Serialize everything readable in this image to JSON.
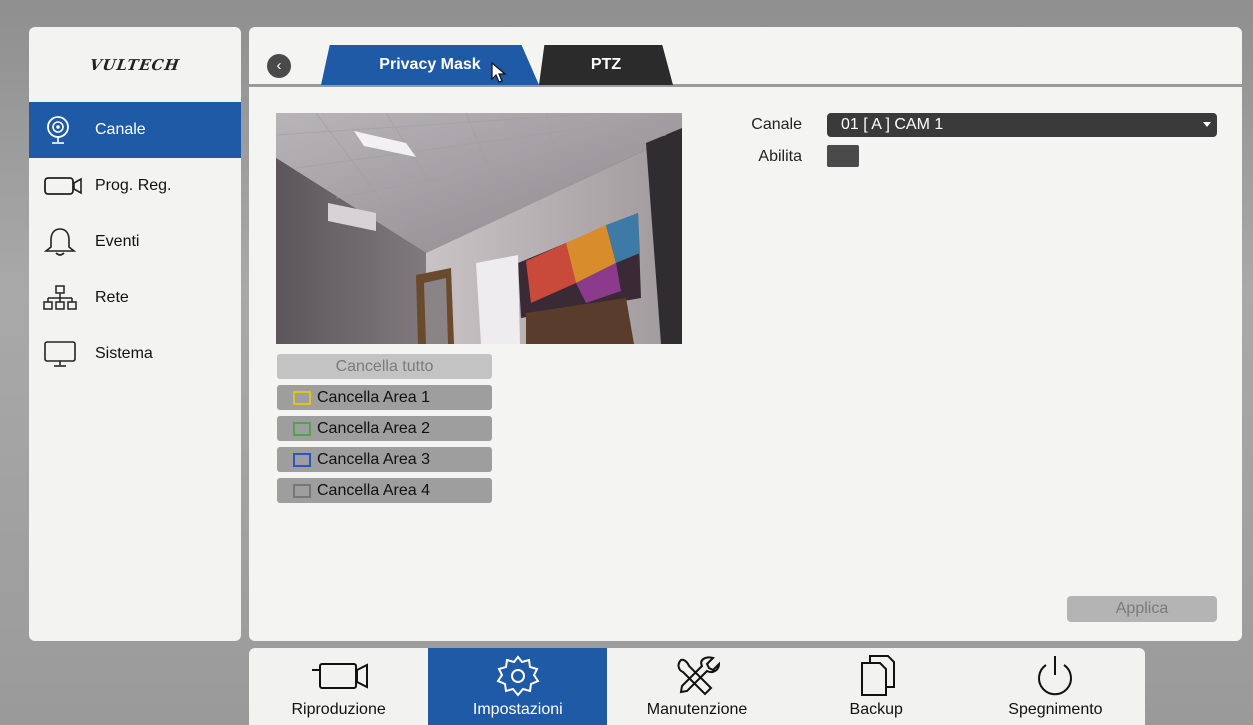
{
  "brand": {
    "logo": "VULTECH"
  },
  "sidebar": {
    "items": [
      {
        "label": "Canale",
        "icon": "camera-icon",
        "active": true
      },
      {
        "label": "Prog. Reg.",
        "icon": "recording-icon",
        "active": false
      },
      {
        "label": "Eventi",
        "icon": "bell-icon",
        "active": false
      },
      {
        "label": "Rete",
        "icon": "network-icon",
        "active": false
      },
      {
        "label": "Sistema",
        "icon": "monitor-icon",
        "active": false
      }
    ]
  },
  "tabs": {
    "back_icon": "chevron-left-icon",
    "items": [
      {
        "label": "Privacy Mask",
        "active": true
      },
      {
        "label": "PTZ",
        "active": false
      }
    ]
  },
  "mask": {
    "clear_all": "Cancella tutto",
    "areas": [
      {
        "label": "Cancella Area 1",
        "color": "#e3c21a"
      },
      {
        "label": "Cancella Area 2",
        "color": "#4fa64a"
      },
      {
        "label": "Cancella Area 3",
        "color": "#2a55c9"
      },
      {
        "label": "Cancella Area 4",
        "color": "#777777"
      }
    ]
  },
  "form": {
    "channel_label": "Canale",
    "channel_value": "01 [ A ] CAM 1",
    "enable_label": "Abilita",
    "enable_checked": false
  },
  "apply_label": "Applica",
  "bottom_menu": [
    {
      "label": "Riproduzione",
      "icon": "video-camera-icon",
      "active": false
    },
    {
      "label": "Impostazioni",
      "icon": "gear-icon",
      "active": true
    },
    {
      "label": "Manutenzione",
      "icon": "tools-icon",
      "active": false
    },
    {
      "label": "Backup",
      "icon": "copy-icon",
      "active": false
    },
    {
      "label": "Spegnimento",
      "icon": "power-icon",
      "active": false
    }
  ],
  "colors": {
    "accent": "#1f5aa6",
    "tab_dark": "#2b2b2b"
  }
}
